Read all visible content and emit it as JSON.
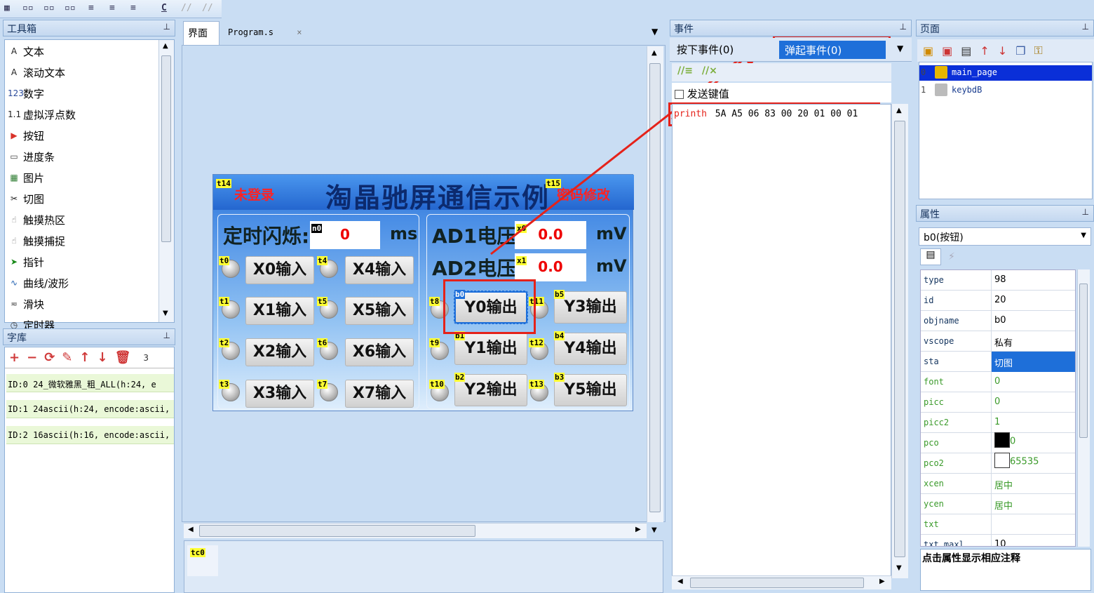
{
  "toolbar": {
    "icons": [
      "grid-icon",
      "align-left-icon",
      "align-center-icon",
      "align-right-icon",
      "align-top-icon",
      "align-middle-icon",
      "align-bottom-icon",
      "c-icon",
      "comment-icon",
      "uncomment-icon"
    ],
    "c_label": "C"
  },
  "toolbox": {
    "title": "工具箱",
    "items": [
      {
        "icon": "text-icon",
        "glyph": "A",
        "label": "文本"
      },
      {
        "icon": "scroll-text-icon",
        "glyph": "A",
        "label": "滚动文本"
      },
      {
        "icon": "number-icon",
        "glyph": "123",
        "label": "数字"
      },
      {
        "icon": "float-icon",
        "glyph": "1.1",
        "label": "虚拟浮点数"
      },
      {
        "icon": "button-icon",
        "glyph": "▶",
        "label": "按钮"
      },
      {
        "icon": "progress-icon",
        "glyph": "▭",
        "label": "进度条"
      },
      {
        "icon": "picture-icon",
        "glyph": "▦",
        "label": "图片"
      },
      {
        "icon": "crop-icon",
        "glyph": "✂",
        "label": "切图"
      },
      {
        "icon": "touch-hotspot-icon",
        "glyph": "☝",
        "label": "触摸热区"
      },
      {
        "icon": "touch-capture-icon",
        "glyph": "☝",
        "label": "触摸捕捉"
      },
      {
        "icon": "pointer-icon",
        "glyph": "➤",
        "label": "指针"
      },
      {
        "icon": "curve-icon",
        "glyph": "∿",
        "label": "曲线/波形"
      },
      {
        "icon": "slider-icon",
        "glyph": "≂",
        "label": "滑块"
      },
      {
        "icon": "timer-icon",
        "glyph": "◷",
        "label": "定时器"
      }
    ]
  },
  "fontlib": {
    "title": "字库",
    "count": "3",
    "rows": [
      "ID:0  24_微软雅黑_粗_ALL(h:24, e",
      "ID:1  24ascii(h:24, encode:ascii,",
      "ID:2  16ascii(h:16, encode:ascii,"
    ]
  },
  "editor_tabs": {
    "screen": "界面",
    "program": "Program.s",
    "close": "×"
  },
  "screen": {
    "title": "淘晶驰屏通信示例",
    "login_status": "未登录",
    "change_password": "密码修改",
    "timer_label": "定时闪烁:",
    "timer_value": "0",
    "timer_unit": "ms",
    "ad1_label": "AD1电压:",
    "ad1_value": "0.0",
    "ad1_unit": "mV",
    "ad2_label": "AD2电压:",
    "ad2_value": "0.0",
    "ad2_unit": "mV",
    "inputs": [
      "X0输入",
      "X1输入",
      "X2输入",
      "X3输入",
      "X4输入",
      "X5输入",
      "X6输入",
      "X7输入"
    ],
    "outputs": [
      "Y0输出",
      "Y1输出",
      "Y2输出",
      "Y3输出",
      "Y4输出",
      "Y5输出"
    ],
    "tags": {
      "t14": "t14",
      "t15": "t15",
      "n0": "n0",
      "x0": "x0",
      "x1": "x1",
      "t0": "t0",
      "t1": "t1",
      "t2": "t2",
      "t3": "t3",
      "t4": "t4",
      "t5": "t5",
      "t6": "t6",
      "t7": "t7",
      "t8": "t8",
      "t9": "t9",
      "t10": "t10",
      "t11": "t11",
      "t12": "t12",
      "t13": "t13",
      "b0": "b0",
      "b1": "b1",
      "b2": "b2",
      "b3": "b3",
      "b4": "b4",
      "b5": "b5"
    }
  },
  "timer_strip": {
    "tag": "tc0"
  },
  "events": {
    "title": "事件",
    "press_tab": "按下事件(0)",
    "release_tab": "弹起事件(0)",
    "send_key": "发送键值",
    "code_keyword": "printh",
    "code_args": "5A A5 06 83 00 20 01 00 01"
  },
  "pages": {
    "title": "页面",
    "items": [
      {
        "index": "0",
        "name": "main_page",
        "selected": true
      },
      {
        "index": "1",
        "name": "keybdB",
        "selected": false
      }
    ]
  },
  "props": {
    "title": "属性",
    "selector": "b0(按钮)",
    "rows": [
      {
        "k": "type",
        "v": "98",
        "green": false
      },
      {
        "k": "id",
        "v": "20",
        "green": false
      },
      {
        "k": "objname",
        "v": "b0",
        "green": false
      },
      {
        "k": "vscope",
        "v": "私有",
        "green": false
      },
      {
        "k": "sta",
        "v": "切图",
        "green": false,
        "selected": true
      },
      {
        "k": "font",
        "v": "0",
        "green": true
      },
      {
        "k": "picc",
        "v": "0",
        "green": true
      },
      {
        "k": "picc2",
        "v": "1",
        "green": true
      },
      {
        "k": "pco",
        "v": "0",
        "green": true,
        "swatch": "#000000"
      },
      {
        "k": "pco2",
        "v": "65535",
        "green": true,
        "swatch": "#ffffff"
      },
      {
        "k": "xcen",
        "v": "居中",
        "green": true
      },
      {
        "k": "ycen",
        "v": "居中",
        "green": true
      },
      {
        "k": "txt",
        "v": "",
        "green": true
      },
      {
        "k": "txt_maxl",
        "v": "10",
        "green": false
      }
    ],
    "hint": "点击属性显示相应注释"
  },
  "colors": {
    "highlight": "#1e6fd9",
    "annotation": "#e5221a",
    "tag": "#ffff33"
  }
}
